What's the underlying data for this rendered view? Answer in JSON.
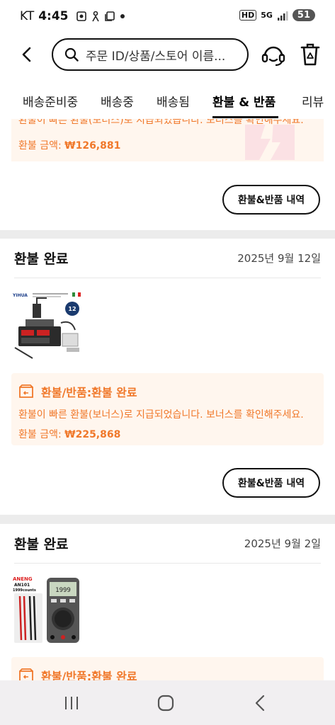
{
  "status_bar": {
    "carrier": "KT",
    "time": "4:45",
    "battery": "51",
    "hd_label": "HD",
    "network_label": "5G"
  },
  "header": {
    "search_placeholder": "주문 ID/상품/스토어 이름..."
  },
  "tabs": [
    {
      "label": "배송준비중",
      "active": false
    },
    {
      "label": "배송중",
      "active": false
    },
    {
      "label": "배송됨",
      "active": false
    },
    {
      "label": "환불 & 반품",
      "active": true
    },
    {
      "label": "리뷰",
      "active": false
    }
  ],
  "partial_card": {
    "cut_text": "환불이 빠른 환불(보너스)로 지급되었습니다. 보너스를 확인해주세요.",
    "amount_label": "환불 금액: ",
    "amount_value": "₩126,881",
    "history_button": "환불&반품 내역"
  },
  "cards": [
    {
      "title": "환불 완료",
      "date": "2025년 9월 12일",
      "product_brand": "YIHUA",
      "product_badge": "12",
      "refund_title": "환불/반품:환불 완료",
      "refund_message": "환불이 빠른 환불(보너스)로 지급되었습니다. 보너스를 확인해주세요.",
      "amount_label": "환불 금액: ",
      "amount_value": "₩225,868",
      "history_button": "환불&반품 내역"
    },
    {
      "title": "환불 완료",
      "date": "2025년 9월 2일",
      "product_brand": "ANENG",
      "product_model": "AN101",
      "product_counts": "1999counts",
      "refund_title": "환불/반품:환불 완료"
    }
  ],
  "colors": {
    "accent_orange": "#f0782a",
    "refund_box_bg": "#fff6ee"
  }
}
